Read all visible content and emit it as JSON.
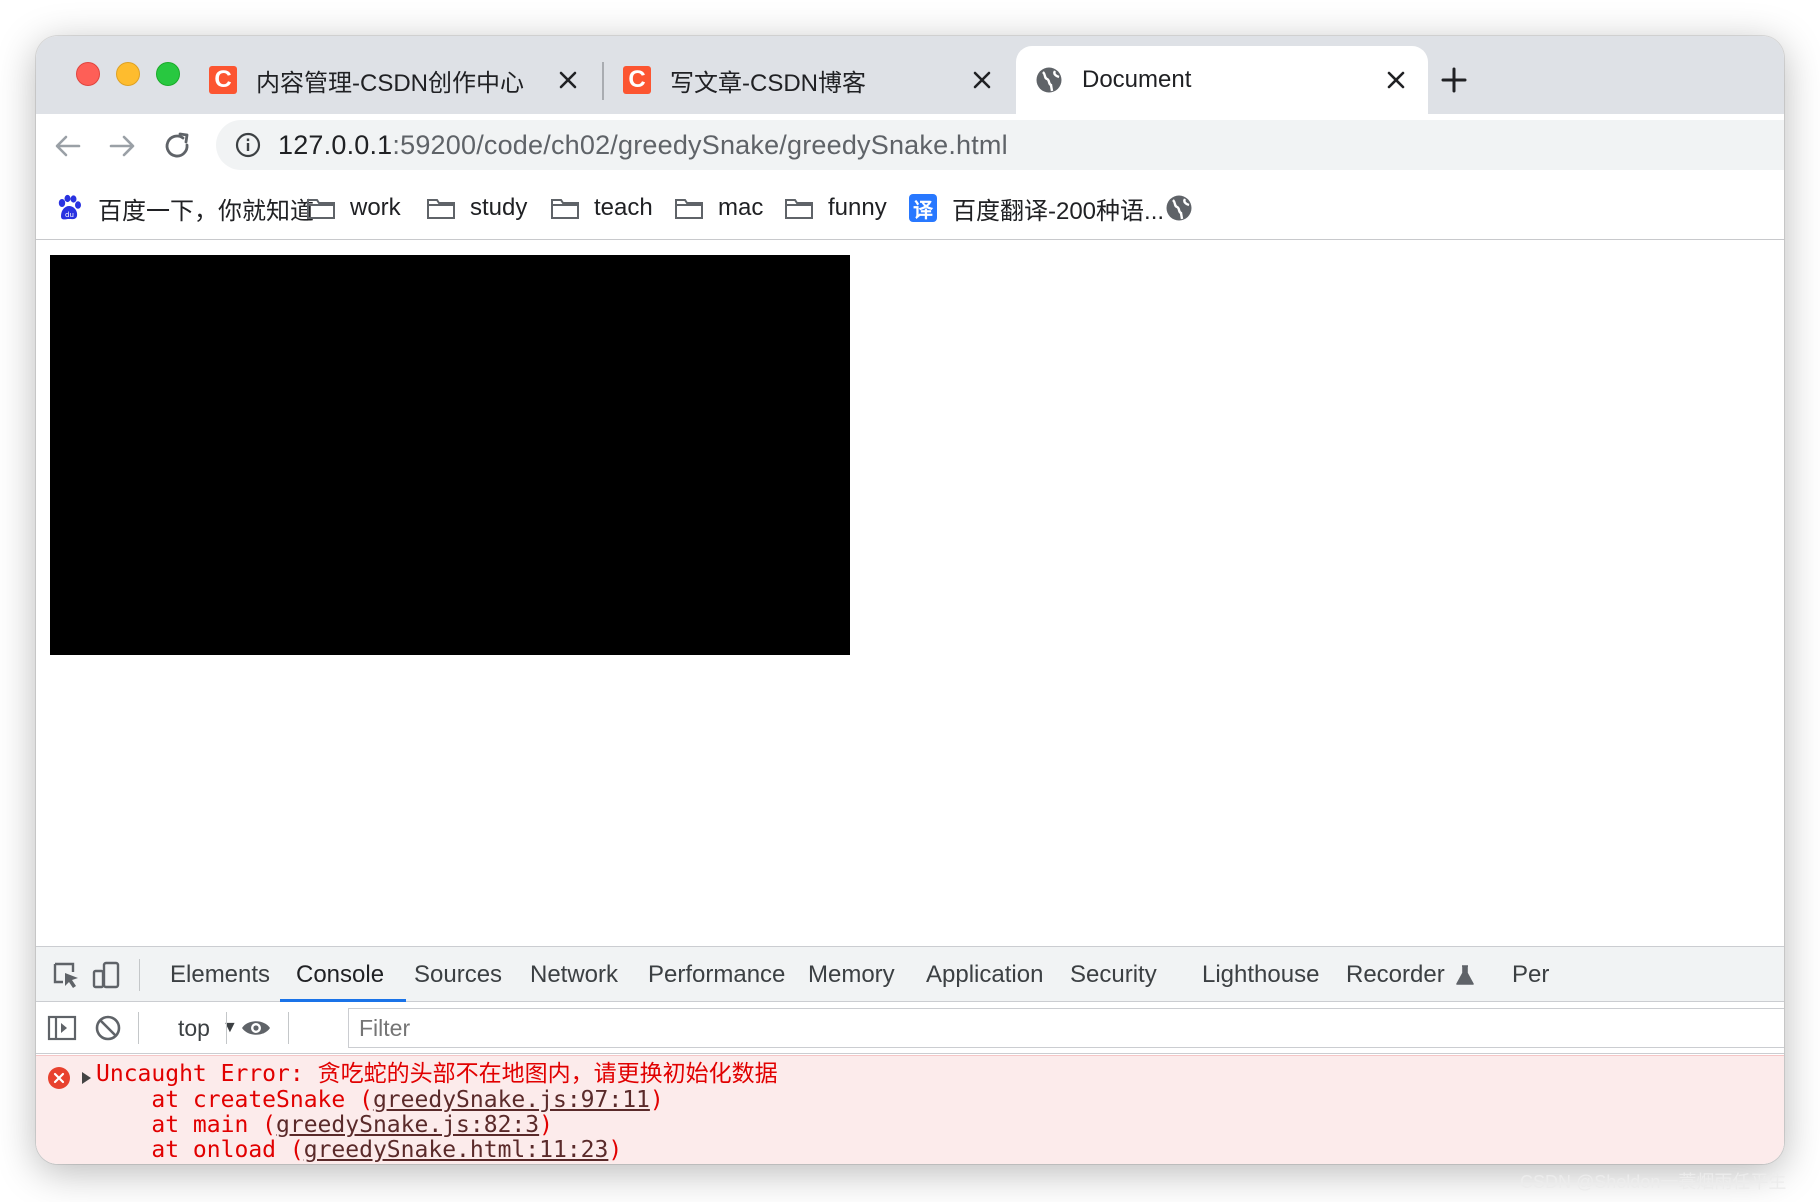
{
  "browser": {
    "tabs": [
      {
        "title": "内容管理-CSDN创作中心",
        "favicon": "csdn-icon",
        "favicon_glyph": "C",
        "active": false
      },
      {
        "title": "写文章-CSDN博客",
        "favicon": "csdn-icon",
        "favicon_glyph": "C",
        "active": false
      },
      {
        "title": "Document",
        "favicon": "globe-icon",
        "active": true
      }
    ],
    "new_tab_icon": "plus-icon",
    "address_bar": {
      "host": "127.0.0.1",
      "rest": ":59200/code/ch02/greedySnake/greedySnake.html",
      "icon": "info-icon"
    },
    "bookmarks": [
      {
        "label": "百度一下，你就知道",
        "icon": "baidu-paw-icon"
      },
      {
        "label": "work",
        "icon": "folder-icon"
      },
      {
        "label": "study",
        "icon": "folder-icon"
      },
      {
        "label": "teach",
        "icon": "folder-icon"
      },
      {
        "label": "mac",
        "icon": "folder-icon"
      },
      {
        "label": "funny",
        "icon": "folder-icon"
      },
      {
        "label": "百度翻译-200种语...",
        "icon": "translate-icon",
        "icon_glyph": "译"
      },
      {
        "label": "",
        "icon": "globe-icon"
      }
    ]
  },
  "page": {
    "canvas": {
      "background": "#000000"
    }
  },
  "devtools": {
    "tabs": [
      "Elements",
      "Console",
      "Sources",
      "Network",
      "Performance",
      "Memory",
      "Application",
      "Security",
      "Lighthouse",
      "Recorder",
      "Per"
    ],
    "active_tab": "Console",
    "context": "top",
    "filter_placeholder": "Filter",
    "error": {
      "prefix": "Uncaught Error: ",
      "message": "贪吃蛇的头部不在地图内，请更换初始化数据",
      "stack": [
        {
          "prefix": "    at createSnake (",
          "link": "greedySnake.js:97:11",
          "suffix": ")"
        },
        {
          "prefix": "    at main (",
          "link": "greedySnake.js:82:3",
          "suffix": ")"
        },
        {
          "prefix": "    at onload (",
          "link": "greedySnake.html:11:23",
          "suffix": ")"
        }
      ]
    }
  },
  "watermark": "CSDN @Sheldon一蓑烟雨任平生",
  "colors": {
    "tabstrip_bg": "#dee1e6",
    "csdn_red": "#fc5531",
    "accent_blue": "#1a73e8",
    "error_red": "#e10000",
    "error_bg": "#fcebeb"
  }
}
